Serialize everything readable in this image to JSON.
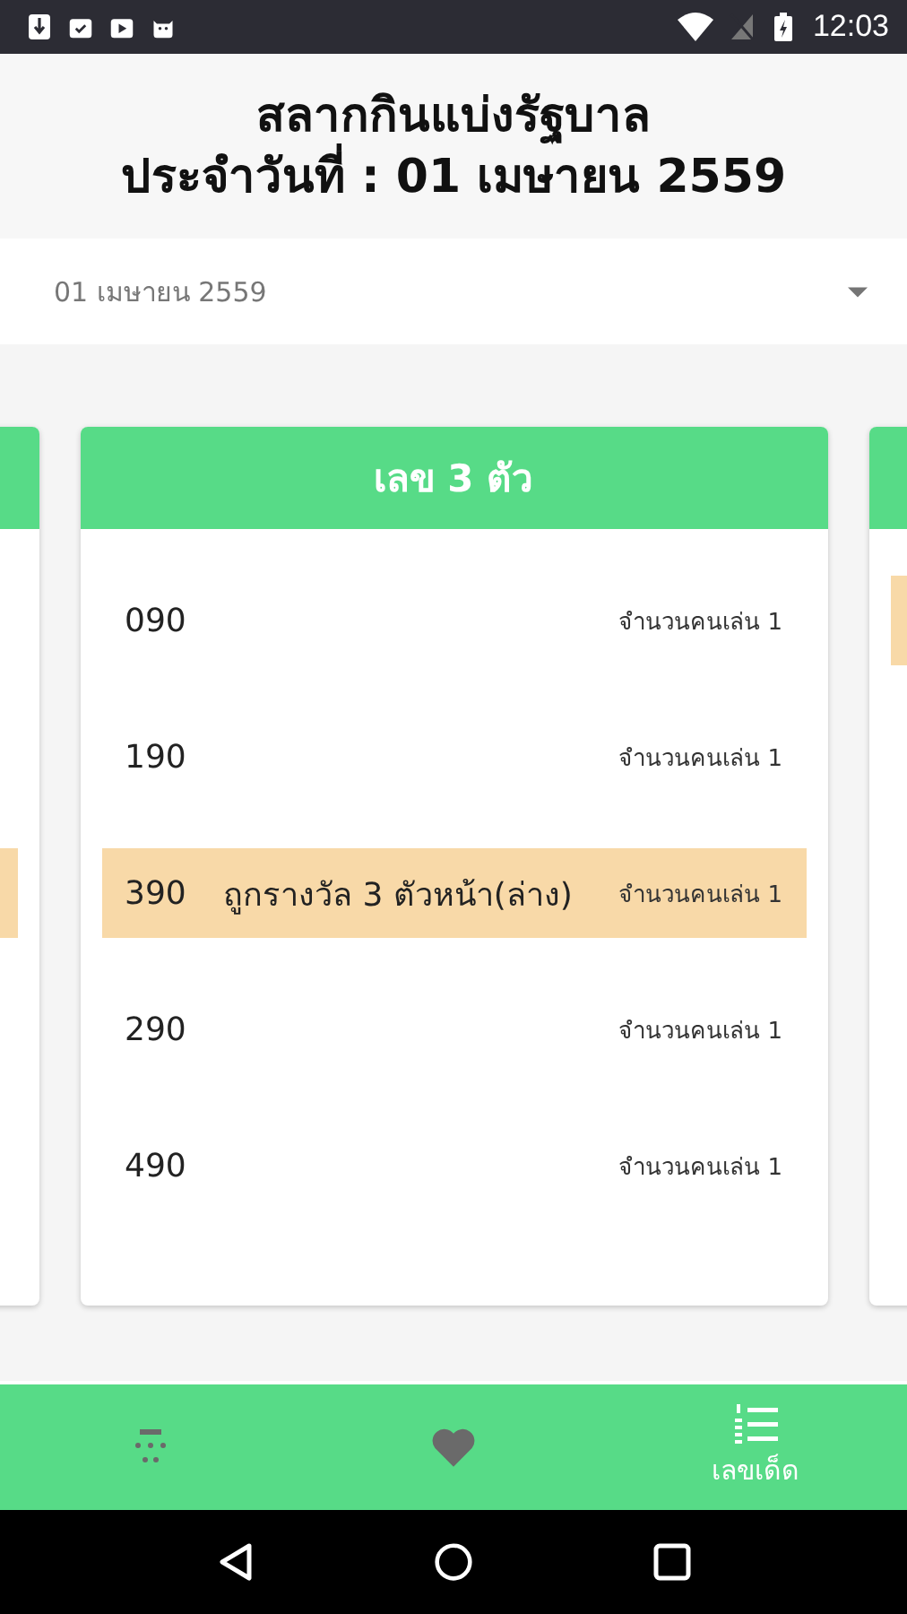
{
  "status_bar": {
    "time": "12:03"
  },
  "header": {
    "title_lines": [
      "สลากกินแบ่งรัฐบาล",
      "ประจำวันที่ : 01 เมษายน 2559"
    ]
  },
  "date_dropdown": {
    "value": "01 เมษายน 2559"
  },
  "side_cards": [
    {
      "rows": [
        {
          "highlighted": false
        },
        {
          "highlighted": false
        },
        {
          "highlighted": true
        },
        {
          "highlighted": false
        },
        {
          "highlighted": false
        }
      ]
    },
    {
      "rows": [
        {
          "highlighted": true
        },
        {
          "highlighted": false
        },
        {
          "highlighted": false
        },
        {
          "highlighted": false
        },
        {
          "highlighted": false
        }
      ]
    }
  ],
  "card": {
    "title": "เลข 3 ตัว",
    "rows": [
      {
        "number": "090",
        "players": "จำนวนคนเล่น 1",
        "highlighted": false
      },
      {
        "number": "190",
        "players": "จำนวนคนเล่น 1",
        "highlighted": false
      },
      {
        "number": "390",
        "prize": "ถูกรางวัล 3 ตัวหน้า(ล่าง)",
        "players": "จำนวนคนเล่น 1",
        "highlighted": true
      },
      {
        "number": "290",
        "players": "จำนวนคนเล่น 1",
        "highlighted": false
      },
      {
        "number": "490",
        "players": "จำนวนคนเล่น 1",
        "highlighted": false
      }
    ]
  },
  "bottom_nav": [
    {
      "kind": "lottery",
      "selected": false
    },
    {
      "kind": "heart",
      "selected": false
    },
    {
      "kind": "list",
      "label": "เลขเด็ด",
      "selected": true
    }
  ]
}
